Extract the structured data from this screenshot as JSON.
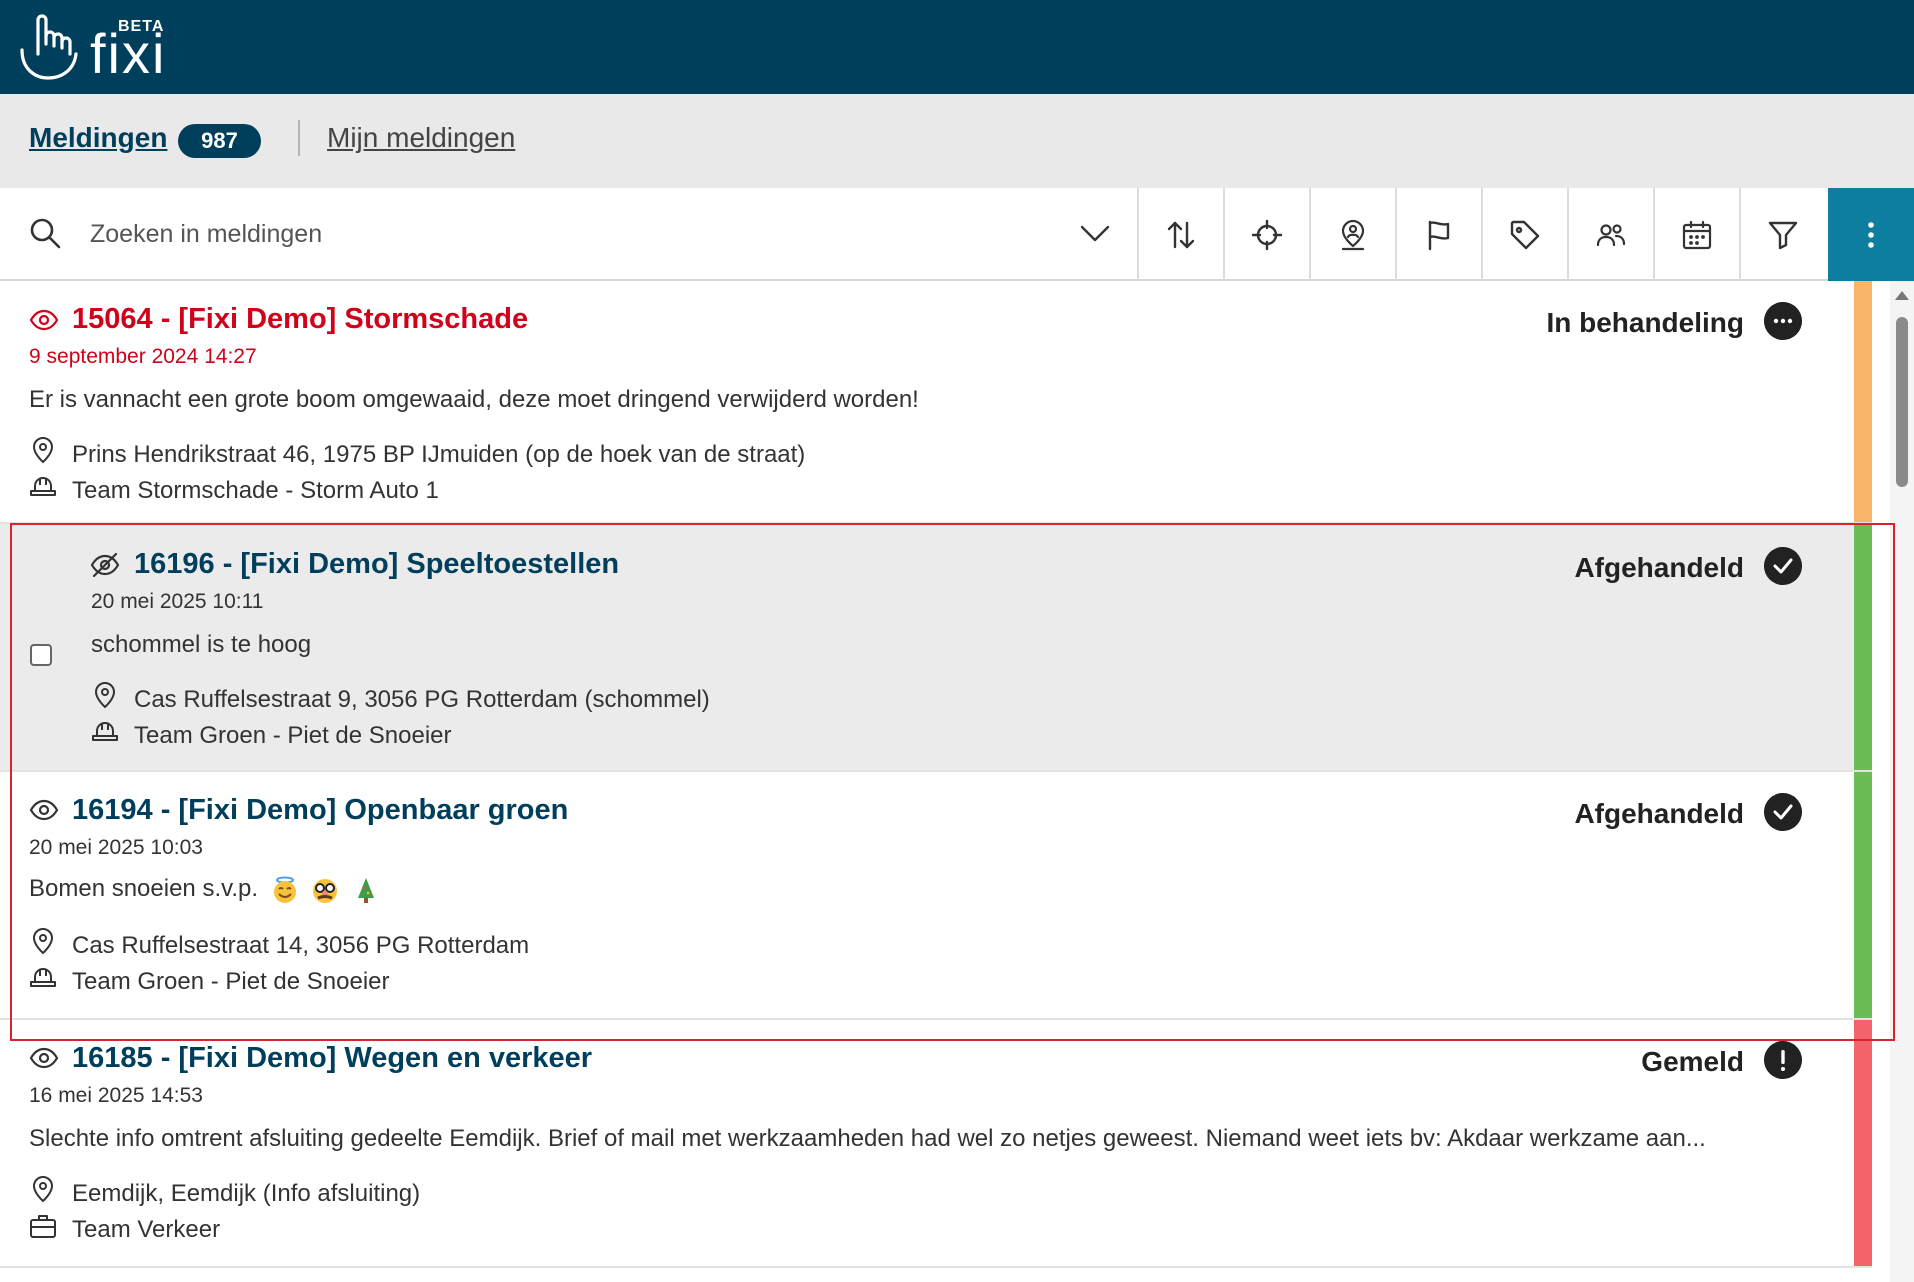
{
  "app": {
    "logo_text": "fixi",
    "beta_label": "BETA"
  },
  "tabs": {
    "meldingen_label": "Meldingen",
    "meldingen_count": "987",
    "mijn_label": "Mijn meldingen"
  },
  "search": {
    "placeholder": "Zoeken in meldingen",
    "value": ""
  },
  "toolbar": {
    "icons": [
      "sort-icon",
      "crosshair-icon",
      "location-user-icon",
      "flag-icon",
      "tag-icon",
      "users-icon",
      "calendar-icon",
      "filter-icon",
      "more-vertical-icon"
    ]
  },
  "colors": {
    "header": "#003f5c",
    "accent": "#0e7ea0",
    "urgent": "#d0021b",
    "stripe_orange": "#f8b56a",
    "stripe_green": "#6dbb55",
    "stripe_red": "#f2636b"
  },
  "items": [
    {
      "title": "15064 - [Fixi Demo] Stormschade",
      "date": "9 september 2024 14:27",
      "description": "Er is vannacht een grote boom omgewaaid, deze moet dringend verwijderd worden!",
      "address": "Prins Hendrikstraat 46, 1975 BP IJmuiden (op de hoek van de straat)",
      "team": "Team Stormschade - Storm Auto 1",
      "status": "In behandeling",
      "status_icon": "dots-icon",
      "stripe": "orange",
      "urgent": true
    },
    {
      "title": "16196 - [Fixi Demo] Speeltoestellen",
      "date": "20 mei 2025 10:11",
      "description": "schommel is te hoog",
      "address": "Cas Ruffelsestraat 9, 3056 PG Rotterdam (schommel)",
      "team": "Team Groen - Piet de Snoeier",
      "status": "Afgehandeld",
      "status_icon": "check-icon",
      "stripe": "green",
      "selected": true
    },
    {
      "title": "16194 - [Fixi Demo] Openbaar groen",
      "date": "20 mei 2025 10:03",
      "description": "Bomen snoeien s.v.p.",
      "address": "Cas Ruffelsestraat 14, 3056 PG Rotterdam",
      "team": "Team Groen - Piet de Snoeier",
      "status": "Afgehandeld",
      "status_icon": "check-icon",
      "stripe": "green"
    },
    {
      "title": "16185 - [Fixi Demo] Wegen en verkeer",
      "date": "16 mei 2025 14:53",
      "description": "Slechte info omtrent afsluiting gedeelte Eemdijk. Brief of mail met werkzaamheden had wel zo netjes geweest. Niemand weet iets bv: Akdaar werkzame aan...",
      "address": "Eemdijk, Eemdijk (Info afsluiting)",
      "team": "Team Verkeer",
      "status": "Gemeld",
      "status_icon": "exclamation-icon",
      "stripe": "red"
    }
  ]
}
